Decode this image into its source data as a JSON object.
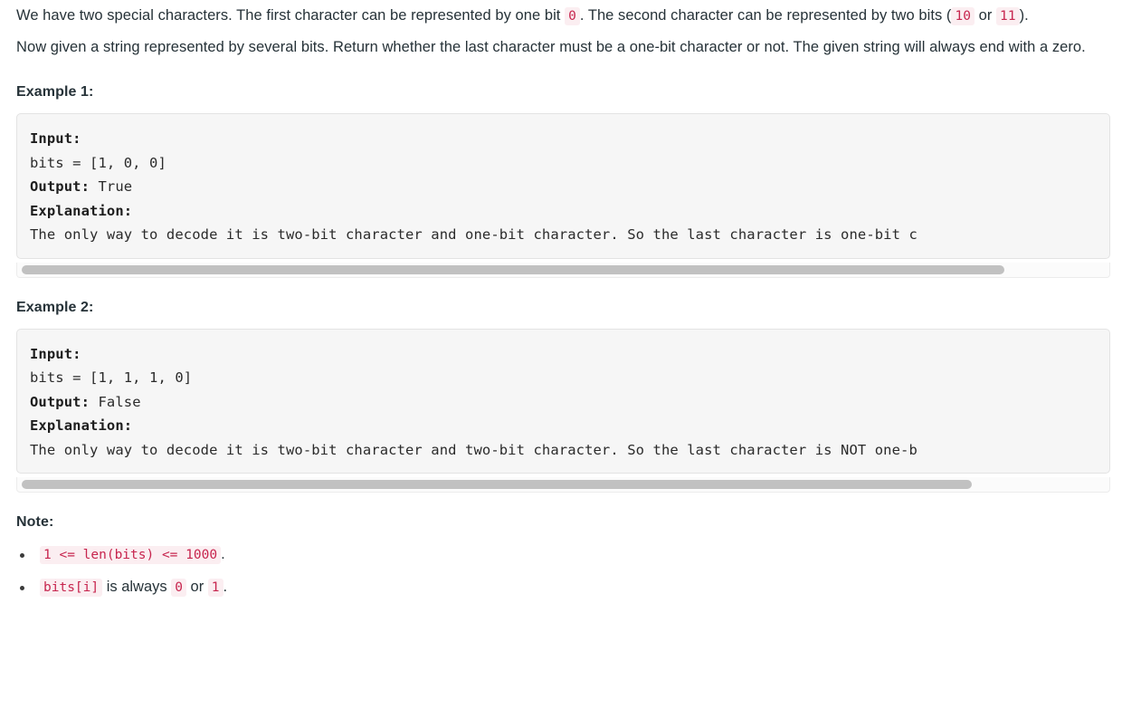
{
  "document": {
    "paragraphs": [
      {
        "id": "intro-1",
        "segments": [
          {
            "type": "text",
            "value": "We have two special characters. The first character can be represented by one bit "
          },
          {
            "type": "code",
            "value": "0"
          },
          {
            "type": "text",
            "value": ". The second character can be represented by two bits ("
          },
          {
            "type": "code",
            "value": "10"
          },
          {
            "type": "text",
            "value": " or "
          },
          {
            "type": "code",
            "value": "11"
          },
          {
            "type": "text",
            "value": ")."
          }
        ]
      },
      {
        "id": "intro-2",
        "segments": [
          {
            "type": "text",
            "value": "Now given a string represented by several bits. Return whether the last character must be a one-bit character or not. The given string will always end with a zero."
          }
        ]
      }
    ],
    "examples": [
      {
        "heading": "Example 1:",
        "input_label": "Input:",
        "input_value": "bits = [1, 0, 0]",
        "output_label": "Output:",
        "output_value": "True",
        "explanation_label": "Explanation:",
        "explanation_value": "The only way to decode it is two-bit character and one-bit character. So the last character is one-bit c",
        "scrollbar": {
          "thumb_left_pct": 0.4,
          "thumb_width_pct": 90.0
        }
      },
      {
        "heading": "Example 2:",
        "input_label": "Input:",
        "input_value": "bits = [1, 1, 1, 0]",
        "output_label": "Output:",
        "output_value": "False",
        "explanation_label": "Explanation:",
        "explanation_value": "The only way to decode it is two-bit character and two-bit character. So the last character is NOT one-b",
        "scrollbar": {
          "thumb_left_pct": 0.4,
          "thumb_width_pct": 87.0
        }
      }
    ],
    "note": {
      "heading": "Note:",
      "items": [
        {
          "segments": [
            {
              "type": "code",
              "value": "1 <= len(bits) <= 1000"
            },
            {
              "type": "text",
              "value": "."
            }
          ]
        },
        {
          "segments": [
            {
              "type": "code",
              "value": "bits[i]"
            },
            {
              "type": "text",
              "value": " is always "
            },
            {
              "type": "code",
              "value": "0"
            },
            {
              "type": "text",
              "value": " or "
            },
            {
              "type": "code",
              "value": "1"
            },
            {
              "type": "text",
              "value": "."
            }
          ]
        }
      ]
    },
    "colors": {
      "page_background": "#ffffff",
      "body_text": "#263238",
      "inline_code_text": "#c7254e",
      "inline_code_background": "#fbeef1",
      "code_block_background": "#f6f6f6",
      "code_block_border": "#e3e3e3",
      "code_block_text": "#2b2b2b",
      "scrollbar_thumb": "#c1c1c1",
      "scrollbar_track": "#fbfbfb",
      "bullet": "#3b3b3b"
    }
  }
}
